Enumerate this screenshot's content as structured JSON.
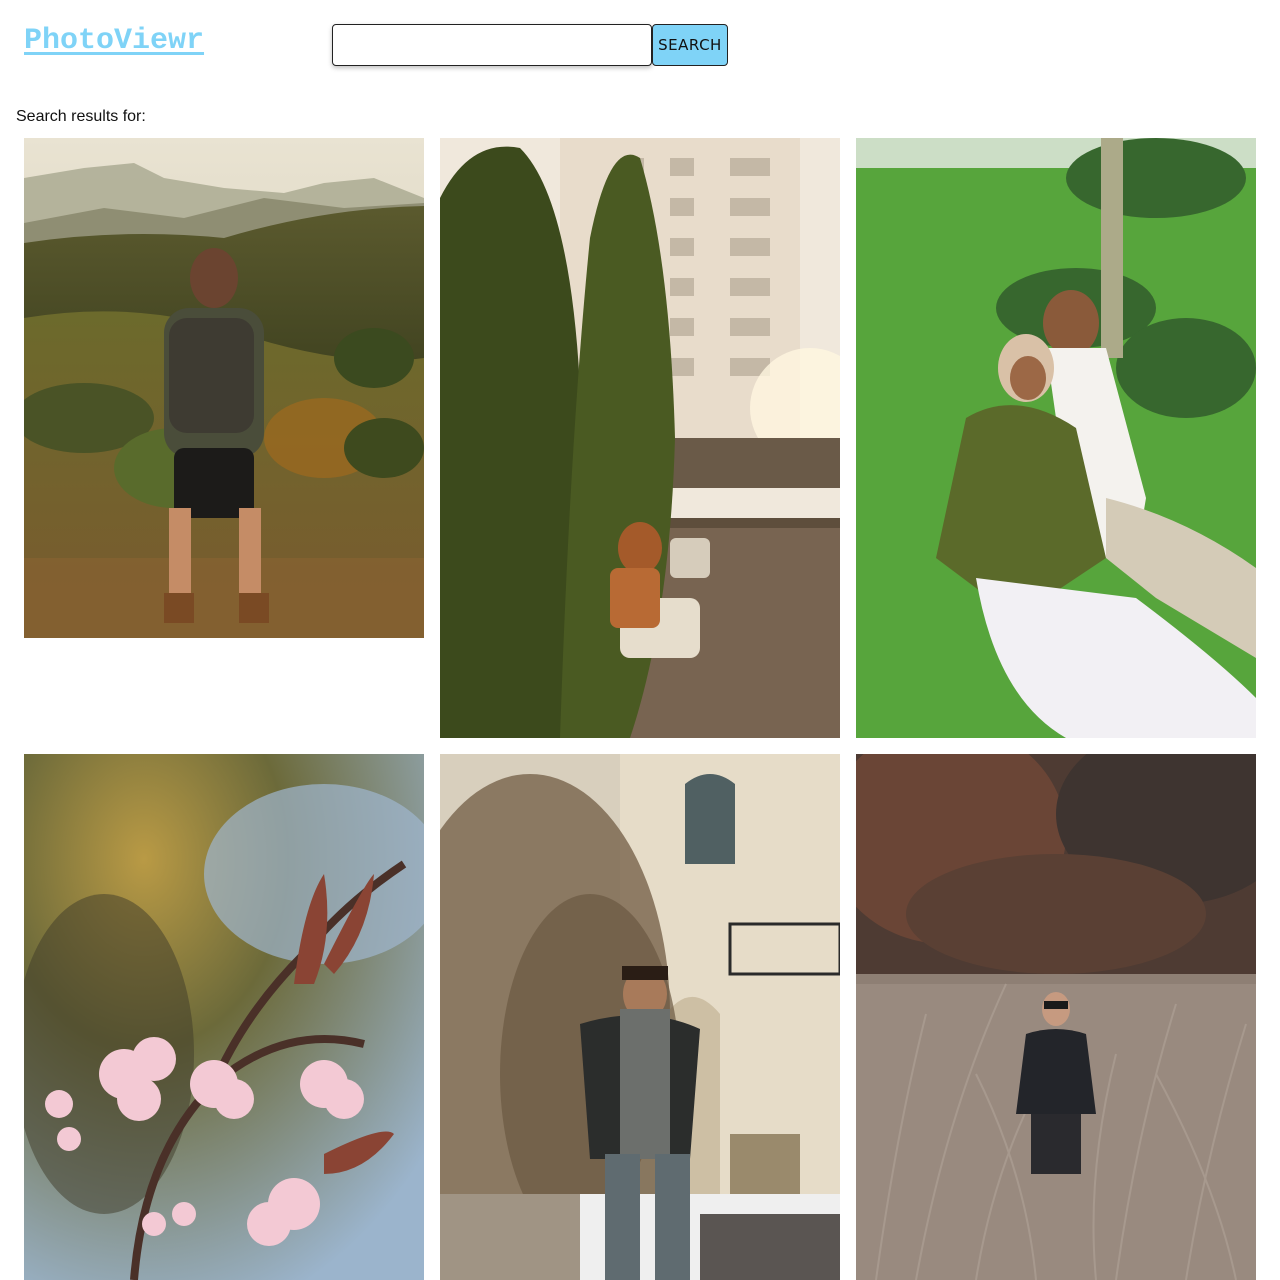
{
  "app": {
    "logo": "PhotoViewr"
  },
  "search": {
    "value": "",
    "placeholder": "",
    "button_label": "SEARCH"
  },
  "results": {
    "label": "Search results for:"
  },
  "colors": {
    "accent": "#7fd3f7"
  },
  "photos": [
    {
      "subject": "hiker-with-backpack-mountains"
    },
    {
      "subject": "people-on-bench-by-cypress-trees"
    },
    {
      "subject": "couple-sitting-on-grass"
    },
    {
      "subject": "pink-cherry-blossom-branch"
    },
    {
      "subject": "man-in-scarf-by-stone-building"
    },
    {
      "subject": "man-in-dry-brush-forest"
    }
  ]
}
